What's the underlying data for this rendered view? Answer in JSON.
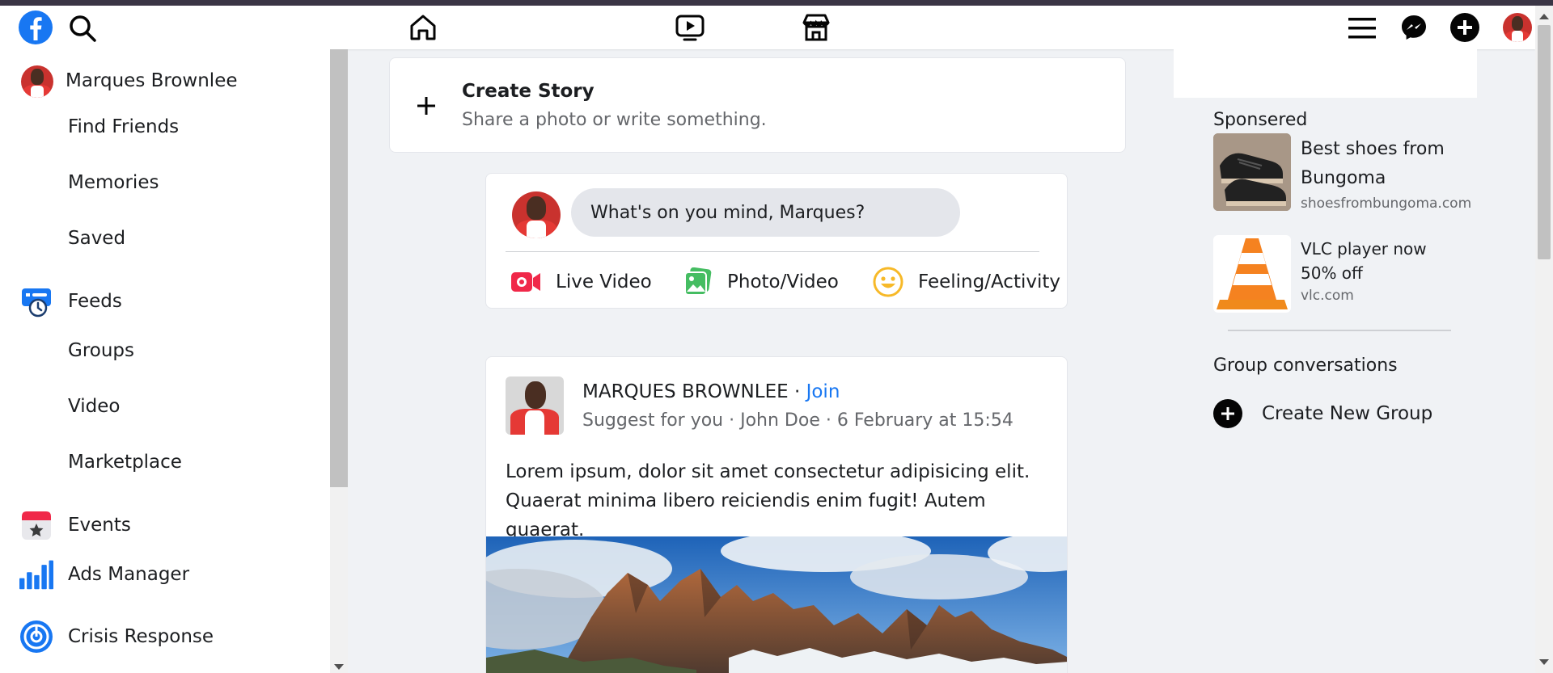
{
  "nav": {
    "logo_icon": "facebook-logo-icon",
    "icons": [
      "search-icon",
      "home-icon",
      "video-icon",
      "marketplace-icon",
      "menu-icon",
      "messenger-icon",
      "plus-icon",
      "profile-avatar"
    ]
  },
  "sidebar": {
    "profile_name": "Marques Brownlee",
    "items": [
      {
        "label": "Find Friends",
        "icon": ""
      },
      {
        "label": "Memories",
        "icon": ""
      },
      {
        "label": "Saved",
        "icon": ""
      },
      {
        "label": "Feeds",
        "icon": "feeds-icon"
      },
      {
        "label": "Groups",
        "icon": ""
      },
      {
        "label": "Video",
        "icon": ""
      },
      {
        "label": "Marketplace",
        "icon": ""
      },
      {
        "label": "Events",
        "icon": "events-icon"
      },
      {
        "label": "Ads Manager",
        "icon": "ads-manager-icon"
      },
      {
        "label": "Crisis Response",
        "icon": "crisis-response-icon"
      }
    ]
  },
  "story": {
    "title": "Create Story",
    "subtitle": "Share a photo or write something."
  },
  "composer": {
    "placeholder": "What's on you mind, Marques?",
    "actions": [
      {
        "label": "Live Video",
        "color": "#f02849"
      },
      {
        "label": "Photo/Video",
        "color": "#45bd62"
      },
      {
        "label": "Feeling/Activity",
        "color": "#f7b928"
      }
    ]
  },
  "post": {
    "author": "MARQUES BROWNLEE",
    "separator": " · ",
    "join": "Join",
    "meta": "Suggest for you · John Doe · 6 February at 15:54",
    "body": "Lorem ipsum, dolor sit amet consectetur adipisicing elit. Quaerat minima libero reiciendis enim fugit! Autem quaerat."
  },
  "right": {
    "sponsored_title": "Sponsered",
    "ads": [
      {
        "title": "Best shoes from Bungoma",
        "domain": "shoesfrombungoma.com"
      },
      {
        "title": "VLC player now 50% off",
        "domain": "vlc.com"
      }
    ],
    "group_title": "Group conversations",
    "create_group": "Create New Group"
  },
  "colors": {
    "brand": "#1877f2",
    "link": "#1877f2",
    "background": "#f0f2f5"
  }
}
